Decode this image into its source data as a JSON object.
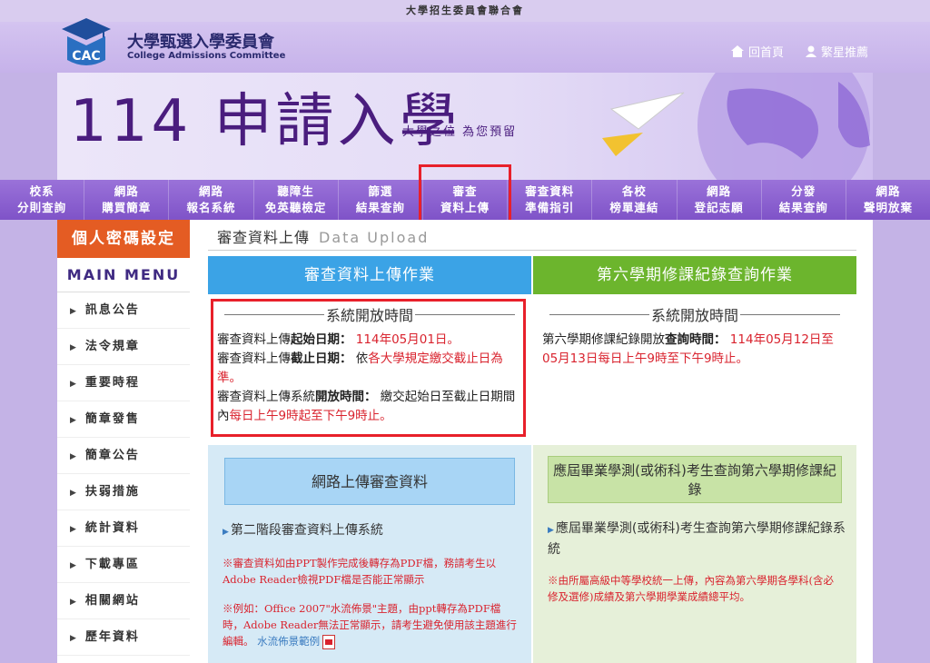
{
  "top_strip": "大學招生委員會聯合會",
  "logo": {
    "abbr": "CAC",
    "name_cn": "大學甄選入學委員會",
    "name_en": "College Admissions Committee"
  },
  "top_links": [
    {
      "label": "回首頁",
      "icon": "home-icon"
    },
    {
      "label": "繁星推薦",
      "icon": "user-icon"
    }
  ],
  "banner": {
    "title": "114 申請入學",
    "subtitle": "大學之位 為您預留"
  },
  "nav": [
    {
      "l1": "校系",
      "l2": "分則查詢"
    },
    {
      "l1": "網路",
      "l2": "購買簡章"
    },
    {
      "l1": "網路",
      "l2": "報名系統"
    },
    {
      "l1": "聽障生",
      "l2": "免英聽檢定"
    },
    {
      "l1": "篩選",
      "l2": "結果查詢"
    },
    {
      "l1": "審查",
      "l2": "資料上傳"
    },
    {
      "l1": "審查資料",
      "l2": "準備指引"
    },
    {
      "l1": "各校",
      "l2": "榜單連結"
    },
    {
      "l1": "網路",
      "l2": "登記志願"
    },
    {
      "l1": "分發",
      "l2": "結果查詢"
    },
    {
      "l1": "網路",
      "l2": "聲明放棄"
    }
  ],
  "sidebar": {
    "top_button": "個人密碼設定",
    "main_menu": "MAIN MENU",
    "items": [
      "訊息公告",
      "法令規章",
      "重要時程",
      "簡章發售",
      "簡章公告",
      "扶弱措施",
      "統計資料",
      "下載專區",
      "相關網站",
      "歷年資料"
    ]
  },
  "page": {
    "title_cn": "審查資料上傳",
    "title_en": "Data Upload"
  },
  "left": {
    "header": "審查資料上傳作業",
    "open_title": "系統開放時間",
    "line1_label_a": "審查資料上傳",
    "line1_label_b": "起始日期：",
    "line1_value": "114年05月01日。",
    "line2_label_a": "審查資料上傳",
    "line2_label_b": "截止日期：",
    "line2_pre": "依",
    "line2_value": "各大學規定繳交截止日為準。",
    "line3_label_a": "審查資料上傳系統",
    "line3_label_b": "開放時間：",
    "line3_pre": "繳交起始日至截止日期間內",
    "line3_value": "每日上午9時起至下午9時止。",
    "sub_button": "網路上傳審查資料",
    "link": "第二階段審查資料上傳系統",
    "note1": "※審查資料如由PPT製作完成後轉存為PDF檔，務請考生以Adobe Reader檢視PDF檔是否能正常顯示",
    "note2": "※例如：Office 2007\"水流佈景\"主題，由ppt轉存為PDF檔時，Adobe Reader無法正常顯示，請考生避免使用該主題進行編輯。",
    "note2_link": "水流佈景範例"
  },
  "right": {
    "header": "第六學期修課紀錄查詢作業",
    "open_title": "系統開放時間",
    "line_label_a": "第六學期修課紀錄開放",
    "line_label_b": "查詢時間：",
    "line_value": "114年05月12日至05月13日每日上午9時至下午9時止。",
    "sub_button": "應屆畢業學測(或術科)考生查詢第六學期修課紀錄",
    "link": "應屆畢業學測(或術科)考生查詢第六學期修課紀錄系統",
    "note": "※由所屬高級中等學校統一上傳，內容為第六學期各學科(含必修及選修)成績及第六學期學業成績總平均。"
  },
  "colors": {
    "accent_purple": "#7f53c8",
    "orange": "#e45c23",
    "blue": "#3ba3e6",
    "green": "#6cb52d",
    "highlight": "#e8202a"
  }
}
